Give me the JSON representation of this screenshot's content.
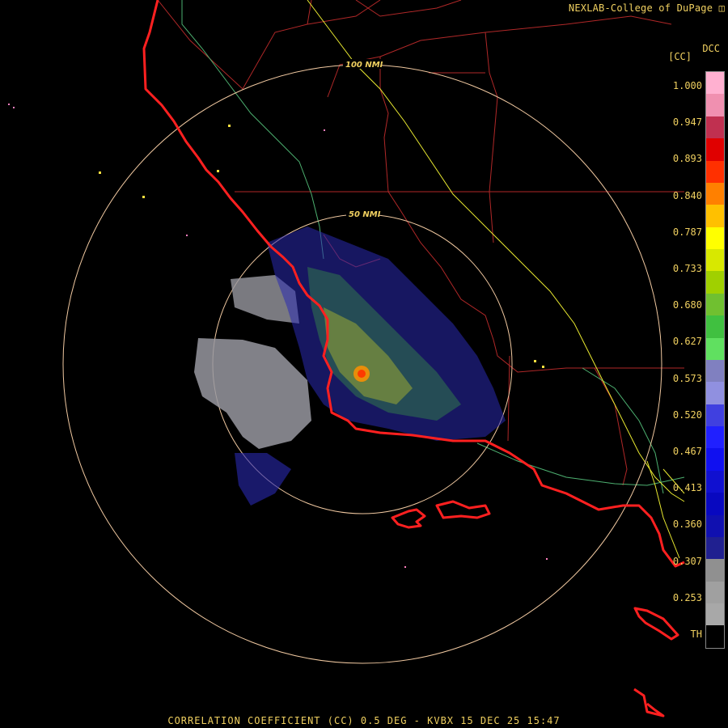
{
  "header": {
    "brand": "NEXLAB-College of DuPage",
    "logo_icon": "nexlab-logo-icon",
    "product_code": "DCC",
    "product_abbr": "[CC]"
  },
  "range_rings": {
    "outer_label": "100 NMI",
    "inner_label": "50 NMI"
  },
  "color_scale": {
    "ticks": [
      "1.000",
      "0.947",
      "0.893",
      "0.840",
      "0.787",
      "0.733",
      "0.680",
      "0.627",
      "0.573",
      "0.520",
      "0.467",
      "0.413",
      "0.360",
      "0.307",
      "0.253",
      "TH"
    ],
    "segments": [
      "#ffb0d0",
      "#f090b0",
      "#c03050",
      "#e00000",
      "#ff3000",
      "#ff8000",
      "#ffc000",
      "#ffff00",
      "#d8e800",
      "#a0d000",
      "#70c030",
      "#40c040",
      "#60e060",
      "#8080c0",
      "#9090e0",
      "#4040e0",
      "#2020ff",
      "#1010f0",
      "#1010d0",
      "#0808c0",
      "#1010b0",
      "#202090",
      "#909090",
      "#a0a0a0",
      "#a8a8a8",
      "#000000"
    ],
    "colors": {
      "accent_text": "#f0d060",
      "ring": "#f0c8a0",
      "border": "#ff3030",
      "county": "#c03030",
      "highway": "#ffff40",
      "river": "#60c080"
    }
  },
  "footer": {
    "caption": "CORRELATION COEFFICIENT (CC) 0.5 DEG - KVBX 15 DEC 25 15:47"
  }
}
